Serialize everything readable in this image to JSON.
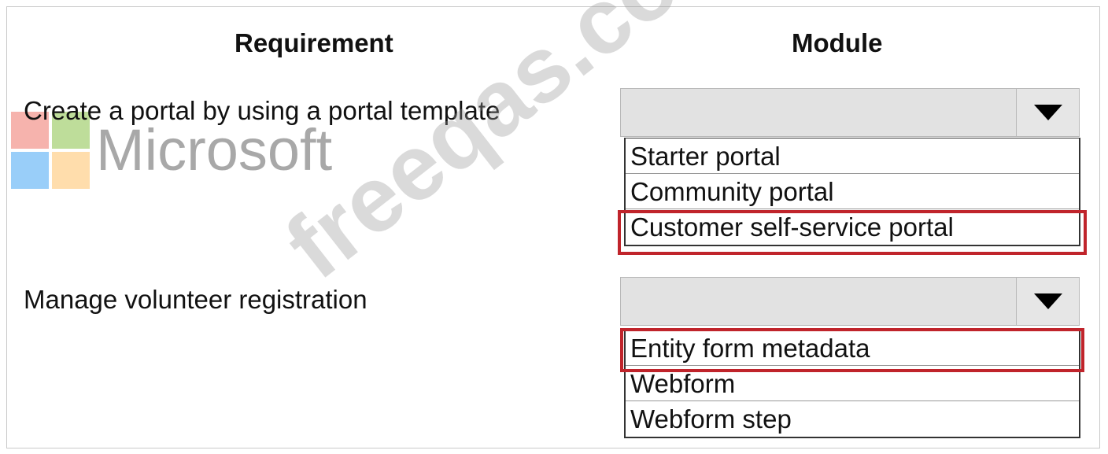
{
  "headers": {
    "requirement": "Requirement",
    "module": "Module"
  },
  "rows": [
    {
      "requirement": "Create a portal by using a portal template",
      "selected": "",
      "options": [
        "Starter portal",
        "Community portal",
        "Customer self-service portal"
      ],
      "highlighted_option": "Customer self-service portal"
    },
    {
      "requirement": "Manage volunteer registration",
      "selected": "",
      "options": [
        "Entity form metadata",
        "Webform",
        "Webform step"
      ],
      "highlighted_option": "Entity form metadata"
    }
  ],
  "watermark": {
    "logo_text": "Microsoft",
    "site_text": "freeqas.com"
  },
  "colors": {
    "highlight": "#c0242b",
    "dropdown_bg": "#e2e2e2",
    "logo_red": "#f25022",
    "logo_green": "#7fba00",
    "logo_blue": "#00a4ef",
    "logo_yellow": "#ffb900"
  },
  "icons": {
    "dropdown_arrow": "triangle-down-icon"
  }
}
